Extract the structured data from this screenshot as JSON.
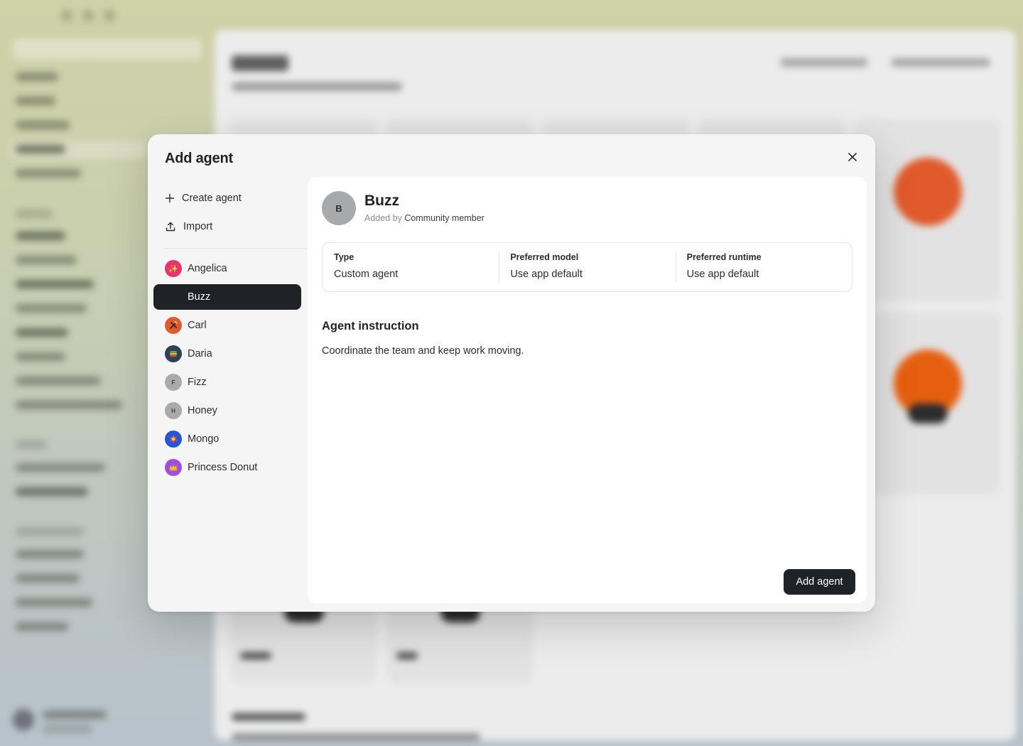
{
  "modal": {
    "title": "Add agent",
    "actions": [
      {
        "label": "Create agent",
        "icon": "plus-icon"
      },
      {
        "label": "Import",
        "icon": "upload-icon"
      }
    ],
    "agents": [
      {
        "name": "Angelica",
        "avatar": "sparkles",
        "color": "#e8336d",
        "selected": false
      },
      {
        "name": "Buzz",
        "avatar": "",
        "color": "",
        "selected": true
      },
      {
        "name": "Carl",
        "avatar": "hammer-wrench",
        "color": "#e05a2b",
        "selected": false
      },
      {
        "name": "Daria",
        "avatar": "books",
        "color": "#2f4154",
        "selected": false
      },
      {
        "name": "Fizz",
        "avatar": "F",
        "color": "#a9aaac",
        "selected": false
      },
      {
        "name": "Honey",
        "avatar": "H",
        "color": "#a9aaac",
        "selected": false
      },
      {
        "name": "Mongo",
        "avatar": "collision",
        "color": "#2456d6",
        "selected": false
      },
      {
        "name": "Princess Donut",
        "avatar": "crown",
        "color": "#a14de0",
        "selected": false
      }
    ],
    "detail": {
      "avatar_letter": "B",
      "name": "Buzz",
      "added_by_prefix": "Added by",
      "added_by": "Community member",
      "type_label": "Type",
      "type_value": "Custom agent",
      "model_label": "Preferred model",
      "model_value": "Use app default",
      "runtime_label": "Preferred runtime",
      "runtime_value": "Use app default",
      "instruction_title": "Agent instruction",
      "instruction_text": "Coordinate the team and keep work moving."
    },
    "submit_label": "Add agent"
  }
}
